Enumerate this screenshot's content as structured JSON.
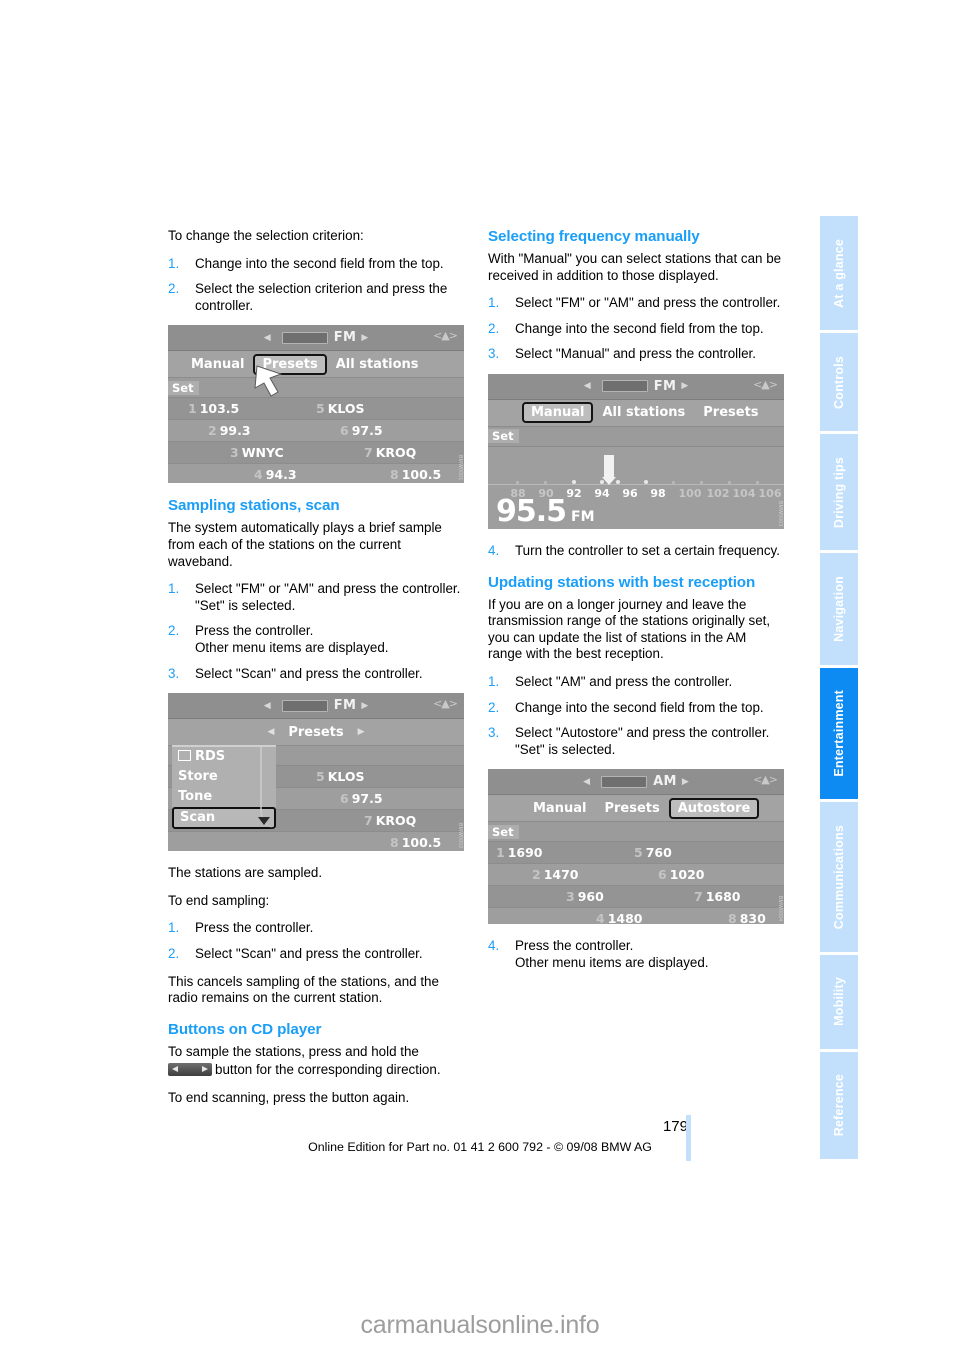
{
  "page": {
    "number": "179",
    "edition_line": "Online Edition for Part no. 01 41 2 600 792 - © 09/08 BMW AG",
    "watermark": "carmanualsonline.info",
    "heading_color": "#1a9ef7",
    "tab_active_color": "#0d8bf2",
    "tab_inactive_color": "#c2e0fb"
  },
  "tabs": [
    {
      "label": "At a glance",
      "active": false
    },
    {
      "label": "Controls",
      "active": false
    },
    {
      "label": "Driving tips",
      "active": false
    },
    {
      "label": "Navigation",
      "active": false
    },
    {
      "label": "Entertainment",
      "active": true
    },
    {
      "label": "Communications",
      "active": false
    },
    {
      "label": "Mobility",
      "active": false
    },
    {
      "label": "Reference",
      "active": false
    }
  ],
  "left_column": {
    "intro_text": "To change the selection criterion:",
    "intro_steps": [
      {
        "num": "1.",
        "text": "Change into the second field from the top."
      },
      {
        "num": "2.",
        "text": "Select the selection criterion and press the controller."
      }
    ],
    "section_sampling": {
      "heading": "Sampling stations, scan",
      "paragraph": "The system automatically plays a brief sample from each of the stations on the current waveband.",
      "steps": [
        {
          "num": "1.",
          "text": "Select \"FM\" or \"AM\" and press the controller.",
          "sub": "\"Set\" is selected."
        },
        {
          "num": "2.",
          "text": "Press the controller.",
          "sub": "Other menu items are displayed."
        },
        {
          "num": "3.",
          "text": "Select \"Scan\" and press the controller.",
          "sub": ""
        }
      ],
      "after_text_1": "The stations are sampled.",
      "after_text_2": "To end sampling:",
      "end_steps": [
        {
          "num": "1.",
          "text": "Press the controller."
        },
        {
          "num": "2.",
          "text": "Select \"Scan\" and press the controller."
        }
      ],
      "closing": "This cancels sampling of the stations, and the radio remains on the current station."
    },
    "section_cd": {
      "heading": "Buttons on CD player",
      "line_a": "To sample the stations, press and hold the",
      "line_b": "button for the corresponding direction.",
      "line_c": "To end scanning, press the button again.",
      "button_icon": "seek-rewind-forward-icon"
    }
  },
  "right_column": {
    "section_manual": {
      "heading": "Selecting frequency manually",
      "paragraph": "With \"Manual\" you can select stations that can be received in addition to those displayed.",
      "steps": [
        {
          "num": "1.",
          "text": "Select \"FM\" or \"AM\" and press the controller."
        },
        {
          "num": "2.",
          "text": "Change into the second field from the top."
        },
        {
          "num": "3.",
          "text": "Select \"Manual\" and press the controller."
        }
      ],
      "step_after": {
        "num": "4.",
        "text": "Turn the controller to set a certain frequency."
      }
    },
    "section_update": {
      "heading": "Updating stations with best reception",
      "paragraph": "If you are on a longer journey and leave the transmission range of the stations originally set, you can update the list of stations in the AM range with the best reception.",
      "steps": [
        {
          "num": "1.",
          "text": "Select \"AM\" and press the controller.",
          "sub": ""
        },
        {
          "num": "2.",
          "text": "Change into the second field from the top.",
          "sub": ""
        },
        {
          "num": "3.",
          "text": "Select \"Autostore\" and press the controller.",
          "sub": "\"Set\" is selected."
        }
      ],
      "step_after": {
        "num": "4.",
        "text": "Press the controller.",
        "sub": "Other menu items are displayed."
      }
    }
  },
  "screenshots": {
    "fm_presets": {
      "band": "FM",
      "menu": [
        {
          "label": "Manual",
          "selected": false
        },
        {
          "label": "Presets",
          "selected": true
        },
        {
          "label": "All stations",
          "selected": false
        }
      ],
      "set_label": "Set",
      "presets": [
        {
          "num": "1",
          "value": "103.5"
        },
        {
          "num": "5",
          "value": "KLOS"
        },
        {
          "num": "2",
          "value": "99.3"
        },
        {
          "num": "6",
          "value": "97.5"
        },
        {
          "num": "3",
          "value": "WNYC"
        },
        {
          "num": "7",
          "value": "KROQ"
        },
        {
          "num": "4",
          "value": "94.3"
        },
        {
          "num": "8",
          "value": "100.5"
        }
      ],
      "cursor": "pointer-arrow-icon"
    },
    "fm_scan": {
      "band": "FM",
      "menu_center_label": "Presets",
      "dropdown": [
        {
          "label": "RDS",
          "checkbox": true,
          "selected": false
        },
        {
          "label": "Store",
          "checkbox": false,
          "selected": false
        },
        {
          "label": "Tone",
          "checkbox": false,
          "selected": false
        },
        {
          "label": "Scan",
          "checkbox": false,
          "selected": true
        }
      ],
      "presets": [
        {
          "num": "5",
          "value": "KLOS"
        },
        {
          "num": "6",
          "value": "97.5"
        },
        {
          "num": "7",
          "value": "KROQ"
        },
        {
          "num": "8",
          "value": "100.5"
        }
      ]
    },
    "fm_manual": {
      "band": "FM",
      "menu": [
        {
          "label": "Manual",
          "selected": true
        },
        {
          "label": "All stations",
          "selected": false
        },
        {
          "label": "Presets",
          "selected": false
        }
      ],
      "set_label": "Set",
      "scale_labels": [
        "88",
        "90",
        "92",
        "94",
        "96",
        "98",
        "100",
        "102",
        "104",
        "106"
      ],
      "scale_bright": [
        "92",
        "94",
        "96",
        "98"
      ],
      "current_frequency": "95.5",
      "current_band": "FM"
    },
    "am_autostore": {
      "band": "AM",
      "menu": [
        {
          "label": "Manual",
          "selected": false
        },
        {
          "label": "Presets",
          "selected": false
        },
        {
          "label": "Autostore",
          "selected": true
        }
      ],
      "set_label": "Set",
      "presets": [
        {
          "num": "1",
          "value": "1690"
        },
        {
          "num": "5",
          "value": "760"
        },
        {
          "num": "2",
          "value": "1470"
        },
        {
          "num": "6",
          "value": "1020"
        },
        {
          "num": "3",
          "value": "960"
        },
        {
          "num": "7",
          "value": "1680"
        },
        {
          "num": "4",
          "value": "1480"
        },
        {
          "num": "8",
          "value": "830"
        }
      ]
    }
  }
}
